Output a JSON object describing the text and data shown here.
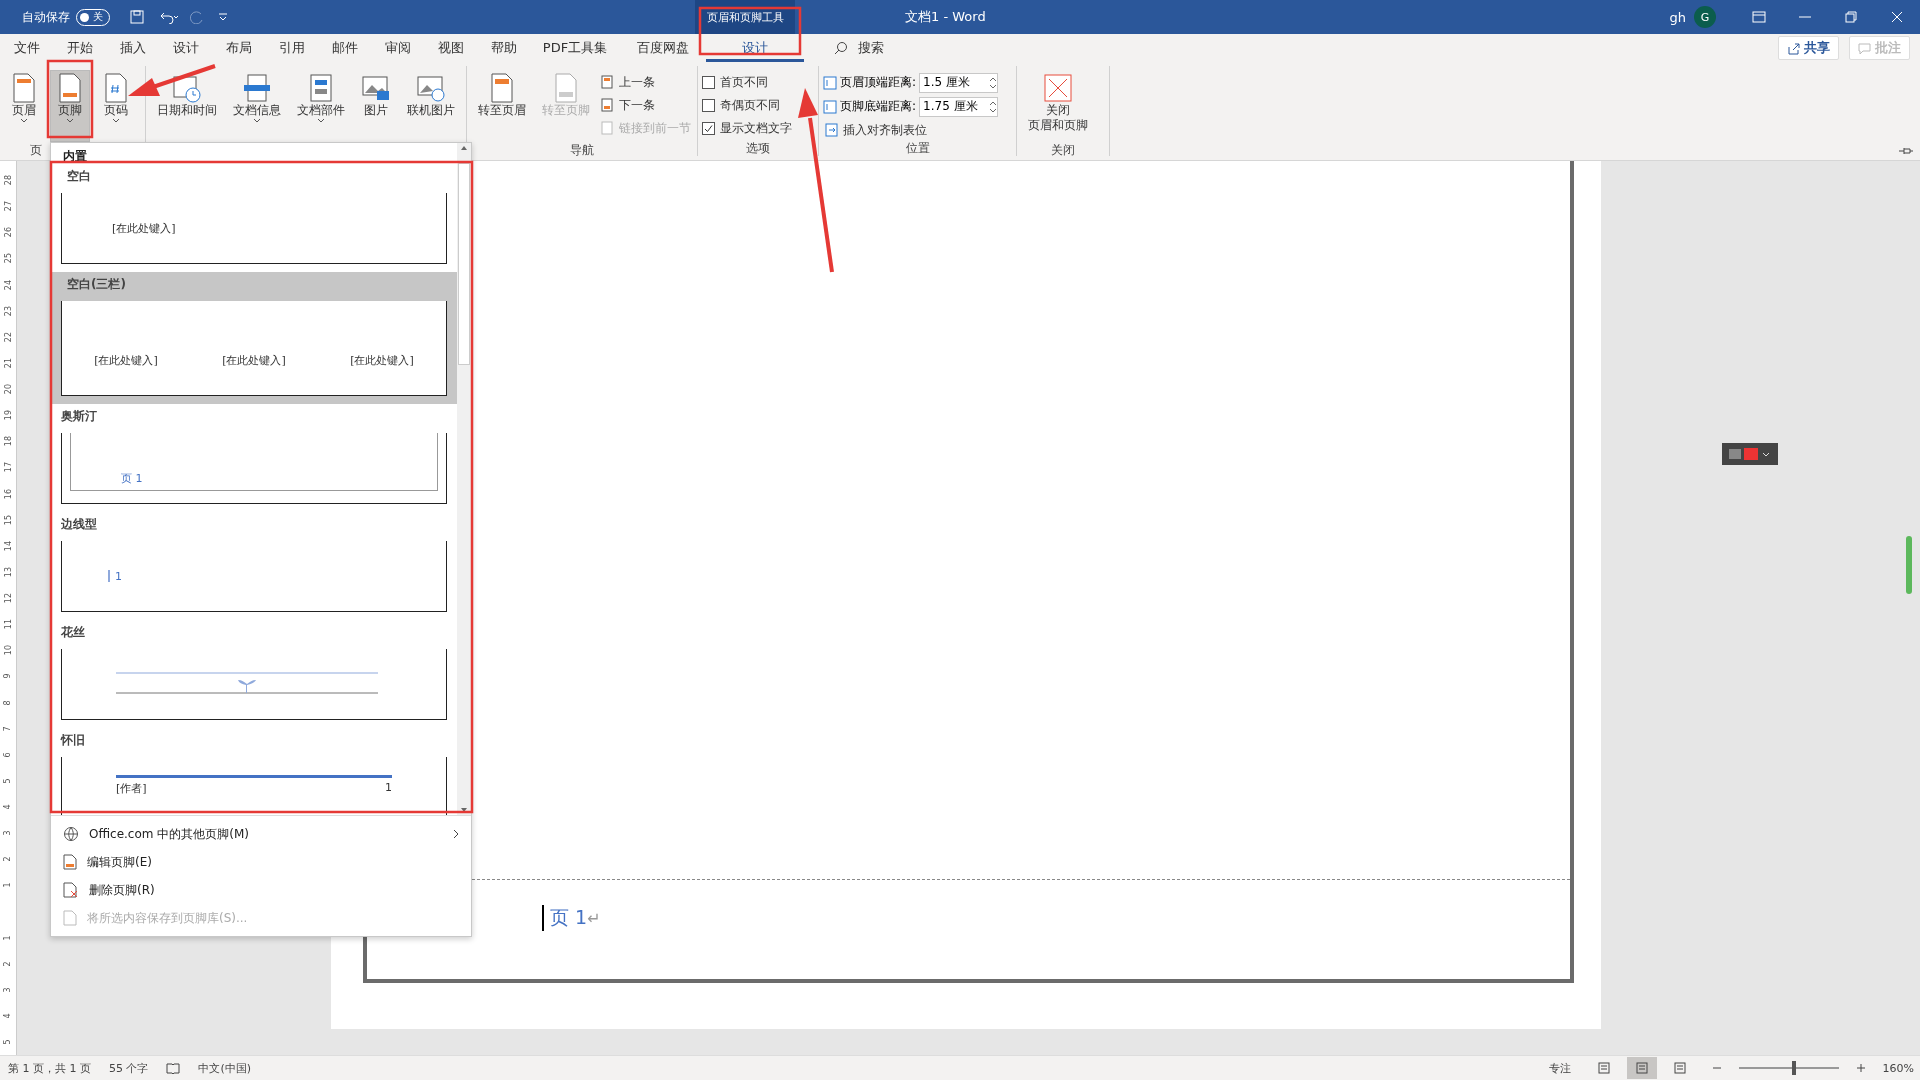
{
  "title_bar": {
    "autosave_label": "自动保存",
    "autosave_toggle": {
      "label": "关",
      "on": false
    },
    "context_title": "页眉和页脚工具",
    "doc_title": "文档1  -  Word",
    "user": "gh",
    "avatar": "G"
  },
  "tabs": [
    {
      "label": "文件",
      "selected": false
    },
    {
      "label": "开始",
      "selected": false
    },
    {
      "label": "插入",
      "selected": false
    },
    {
      "label": "设计",
      "selected": false
    },
    {
      "label": "布局",
      "selected": false
    },
    {
      "label": "引用",
      "selected": false
    },
    {
      "label": "邮件",
      "selected": false
    },
    {
      "label": "审阅",
      "selected": false
    },
    {
      "label": "视图",
      "selected": false
    },
    {
      "label": "帮助",
      "selected": false
    },
    {
      "label": "PDF工具集",
      "selected": false
    },
    {
      "label": "百度网盘",
      "selected": false
    },
    {
      "label": "设计",
      "selected": true
    }
  ],
  "search": {
    "label": "搜索"
  },
  "share": {
    "label": "共享"
  },
  "comments": {
    "label": "批注",
    "disabled": true
  },
  "ribbon": [
    {
      "label": "页",
      "items": [
        {
          "kind": "large",
          "label": "页眉",
          "dropdown": true,
          "selected": false
        },
        {
          "kind": "large",
          "label": "页脚",
          "dropdown": true,
          "selected": true
        },
        {
          "kind": "large",
          "label": "页码",
          "dropdown": true,
          "selected": false
        }
      ]
    },
    {
      "items": [
        {
          "kind": "large",
          "label": "日期和时间",
          "dropdown": false,
          "selected": false
        },
        {
          "kind": "large",
          "label": "文档信息",
          "dropdown": true,
          "selected": false
        },
        {
          "kind": "large",
          "label": "文档部件",
          "dropdown": true,
          "selected": false
        },
        {
          "kind": "large",
          "label": "图片",
          "dropdown": false,
          "selected": false
        },
        {
          "kind": "large",
          "label": "联机图片",
          "dropdown": false,
          "selected": false
        }
      ]
    },
    {
      "label": "导航",
      "items": [
        {
          "kind": "large",
          "label": "转至页眉",
          "dropdown": false,
          "selected": false
        },
        {
          "kind": "large",
          "label": "转至页脚",
          "dropdown": false,
          "selected": false,
          "disabled": true
        },
        {
          "kind": "small",
          "label": "上一条"
        },
        {
          "kind": "small",
          "label": "下一条"
        },
        {
          "kind": "small",
          "label": "链接到前一节",
          "disabled": true
        }
      ]
    },
    {
      "label": "选项",
      "items": [
        {
          "kind": "check",
          "label": "首页不同",
          "checked": false
        },
        {
          "kind": "check",
          "label": "奇偶页不同",
          "checked": false
        },
        {
          "kind": "check",
          "label": "显示文档文字",
          "checked": true
        }
      ]
    },
    {
      "label": "位置",
      "items": [
        {
          "kind": "spin",
          "label": "页眉顶端距离:",
          "value": "1.5 厘米"
        },
        {
          "kind": "spin",
          "label": "页脚底端距离:",
          "value": "1.75 厘米"
        },
        {
          "kind": "small",
          "label": "插入对齐制表位"
        }
      ]
    },
    {
      "label": "关闭",
      "items": [
        {
          "kind": "large",
          "label_lines": [
            "关闭",
            "页眉和页脚"
          ],
          "dropdown": false,
          "selected": false
        }
      ]
    }
  ],
  "gallery": {
    "heading": "内置",
    "items": [
      {
        "name": "空白",
        "texts": [
          "[在此处键入]"
        ],
        "selected": false
      },
      {
        "name": "空白(三栏)",
        "texts": [
          "[在此处键入]",
          "[在此处键入]",
          "[在此处键入]"
        ],
        "selected": true
      },
      {
        "name": "奥斯汀",
        "texts": [
          "页 1"
        ],
        "selected": false
      },
      {
        "name": "边线型",
        "texts": [
          "1"
        ],
        "selected": false
      },
      {
        "name": "花丝",
        "selected": false
      },
      {
        "name": "怀旧",
        "texts": [
          "[作者]",
          "1"
        ],
        "selected": false
      }
    ],
    "menu": [
      {
        "label": "Office.com 中的其他页脚(M)",
        "submenu": true,
        "disabled": false
      },
      {
        "label": "编辑页脚(E)",
        "submenu": false,
        "disabled": false
      },
      {
        "label": "删除页脚(R)",
        "submenu": false,
        "disabled": false
      },
      {
        "label": "将所选内容保存到页脚库(S)...",
        "submenu": false,
        "disabled": true
      }
    ]
  },
  "ruler": [
    "28",
    "27",
    "26",
    "25",
    "24",
    "23",
    "22",
    "21",
    "20",
    "19",
    "18",
    "17",
    "16",
    "15",
    "14",
    "13",
    "12",
    "11",
    "10",
    "9",
    "8",
    "7",
    "6",
    "5",
    "4",
    "3",
    "2",
    "1",
    "1",
    "2",
    "3",
    "4",
    "5"
  ],
  "document": {
    "footer_text": "页 1",
    "paragraph_mark": "↵"
  },
  "status_bar": {
    "page": "第 1 页，共 1 页",
    "words": "55 个字",
    "language": "中文(中国)",
    "focus": "专注",
    "views": [
      {
        "selected": false
      },
      {
        "selected": true
      },
      {
        "selected": false
      }
    ],
    "zoom": {
      "level": 0.55,
      "label": "160%"
    }
  }
}
